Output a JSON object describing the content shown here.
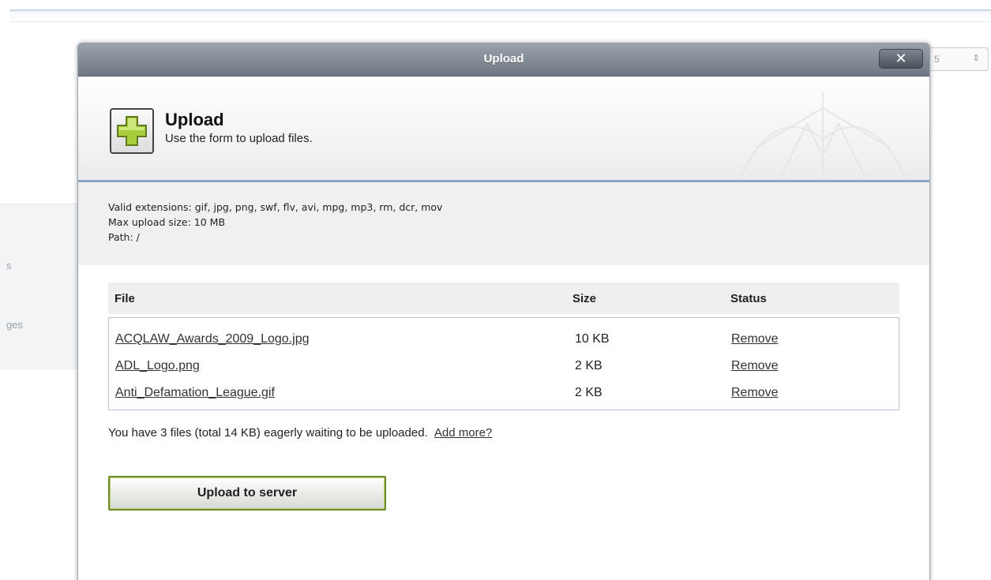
{
  "background": {
    "left_items": [
      "s",
      "ges"
    ],
    "select_value": "5",
    "select_arrow": "⇕"
  },
  "modal": {
    "title": "Upload",
    "close_label": "✕"
  },
  "header": {
    "icon": "plus-icon",
    "title": "Upload",
    "subtitle": "Use the form to upload files."
  },
  "info": {
    "extensions": "Valid extensions: gif, jpg, png, swf, flv, avi, mpg, mp3, rm, dcr, mov",
    "max_size": "Max upload size: 10 MB",
    "path": "Path: /"
  },
  "table": {
    "headers": {
      "file": "File",
      "size": "Size",
      "status": "Status"
    },
    "rows": [
      {
        "file": "ACQLAW_Awards_2009_Logo.jpg",
        "size": "10 KB",
        "action": "Remove"
      },
      {
        "file": "ADL_Logo.png",
        "size": "2 KB",
        "action": "Remove"
      },
      {
        "file": "Anti_Defamation_League.gif",
        "size": "2 KB",
        "action": "Remove"
      }
    ]
  },
  "summary": {
    "text": "You have 3 files (total 14 KB) eagerly waiting to be uploaded.",
    "add_more": "Add more?"
  },
  "upload_button": "Upload to server",
  "colors": {
    "titlebar": "#7d868f",
    "accent_border": "#8da6cc",
    "button_border": "#6f8d2a",
    "plus_icon": "#a8cc3c"
  }
}
